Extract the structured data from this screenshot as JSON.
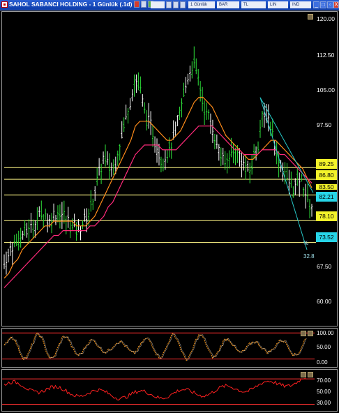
{
  "window": {
    "title": "SAHOL SABANCI HOLDING - 1 Günlük (.1d)",
    "tabs": [
      "1 Günlük",
      "BAR",
      "TL",
      "LIN",
      "IND"
    ],
    "buttons": [
      "_",
      "□",
      "▫",
      "X"
    ]
  },
  "colors": {
    "up_bar": "#2ee23a",
    "down_bar": "#ffffff",
    "ma_fast": "#ff8c1a",
    "ma_slow": "#ff2a7a",
    "level_line": "#e8e07a",
    "trend_line": "#25c6c6",
    "osc1_line": "#ff9a1a",
    "osc2_line": "#ff2020",
    "band_line": "#ff3030"
  },
  "main_chart": {
    "axis_labels": [
      "120.00",
      "112.50",
      "105.00",
      "97.50",
      "67.50",
      "60.00"
    ],
    "levels": [
      {
        "value": "89.25",
        "box": "#f2f22a"
      },
      {
        "value": "86.80",
        "box": "#f2f22a"
      },
      {
        "value": "83.50",
        "box": "#f2f22a"
      },
      {
        "value": "82.21",
        "box": "#27d5e8"
      },
      {
        "value": "78.10",
        "box": "#f2f22a"
      },
      {
        "value": "73.52",
        "box": "#27d5e8"
      }
    ],
    "extra_labels": {
      "percent": "%",
      "projection": "32.8"
    }
  },
  "osc1": {
    "axis_labels": [
      "100.00",
      "50.00",
      "0.00"
    ]
  },
  "osc2": {
    "axis_labels": [
      "70.00",
      "50.00",
      "30.00"
    ]
  },
  "chart_data": {
    "type": "line",
    "title": "SAHOL SABANCI HOLDING - 1 Günlük (.1d)",
    "ylim": [
      56,
      122
    ],
    "horizontal_levels": [
      89.25,
      86.8,
      83.5,
      78.1,
      73.52
    ],
    "last_price": 82.21,
    "series": [
      {
        "values": [
          69,
          71,
          73,
          74,
          75,
          76,
          77,
          78,
          79,
          80,
          78,
          79,
          80,
          79,
          78,
          77,
          76,
          77,
          79,
          80,
          84,
          88,
          91,
          90,
          89,
          92,
          96,
          100,
          104,
          108,
          106,
          101,
          99,
          96,
          93,
          91,
          92,
          94,
          97,
          101,
          106,
          110,
          111,
          107,
          103,
          100,
          98,
          94,
          92,
          90,
          92,
          93,
          92,
          90,
          88,
          91,
          94,
          99,
          101,
          98,
          93,
          90,
          88,
          86,
          85,
          87,
          86,
          82,
          81
        ]
      },
      {
        "values": [
          66,
          67,
          69,
          70,
          72,
          73,
          74,
          75,
          76,
          77,
          77,
          78,
          78,
          78,
          78,
          78,
          77,
          77,
          77,
          78,
          79,
          81,
          83,
          85,
          87,
          89,
          91,
          93,
          95,
          98,
          99,
          99,
          99,
          98,
          97,
          96,
          95,
          95,
          96,
          97,
          99,
          101,
          103,
          104,
          104,
          103,
          102,
          100,
          98,
          96,
          95,
          94,
          93,
          92,
          91,
          91,
          92,
          93,
          94,
          95,
          95,
          94,
          93,
          92,
          91,
          90,
          89,
          87,
          85
        ]
      },
      {
        "values": [
          64,
          65,
          66,
          67,
          68,
          69,
          70,
          71,
          72,
          73,
          74,
          75,
          75,
          76,
          76,
          76,
          76,
          76,
          76,
          77,
          77,
          78,
          79,
          81,
          82,
          84,
          86,
          88,
          90,
          92,
          93,
          94,
          94,
          94,
          94,
          93,
          93,
          93,
          93,
          94,
          95,
          96,
          97,
          98,
          98,
          98,
          98,
          97,
          96,
          95,
          94,
          93,
          93,
          92,
          92,
          92,
          92,
          93,
          93,
          93,
          93,
          92,
          92,
          91,
          90,
          89,
          88,
          87,
          86
        ]
      }
    ]
  }
}
